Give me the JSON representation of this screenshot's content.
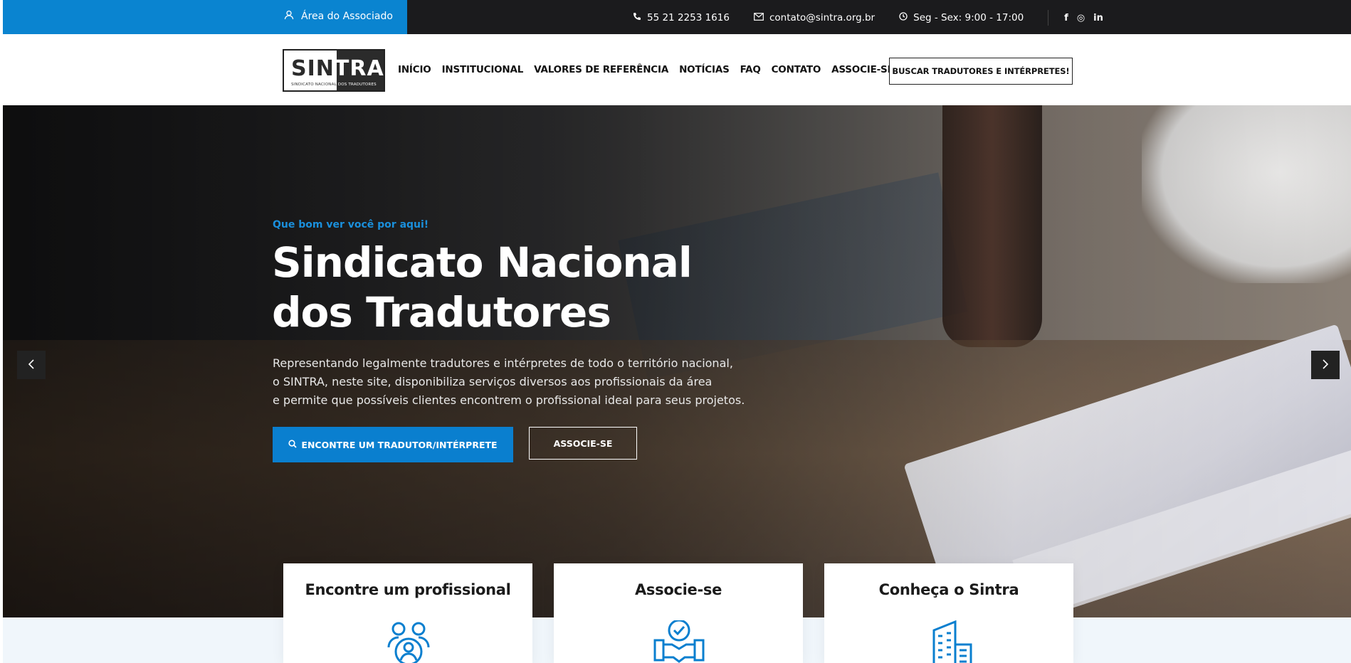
{
  "topbar": {
    "associate_label": "Área do Associado",
    "phone": "55 21 2253 1616",
    "email": "contato@sintra.org.br",
    "hours": "Seg - Sex: 9:00 - 17:00",
    "social": [
      {
        "name": "facebook-icon",
        "glyph": "f"
      },
      {
        "name": "instagram-icon",
        "glyph": "◎"
      },
      {
        "name": "linkedin-icon",
        "glyph": "in"
      }
    ]
  },
  "header": {
    "logo": {
      "word_part1": "SIN",
      "word_part2": "TRA",
      "tagline_part1": "SINDICATO NACIONAL",
      "tagline_part2": "DOS TRADUTORES"
    },
    "nav": [
      "INÍCIO",
      "INSTITUCIONAL",
      "VALORES DE REFERÊNCIA",
      "NOTÍCIAS",
      "FAQ",
      "CONTATO",
      "ASSOCIE-SE"
    ],
    "search_button": "BUSCAR TRADUTORES E INTÉRPRETES!"
  },
  "hero": {
    "kicker": "Que bom ver você por aqui!",
    "title_line1": "Sindicato Nacional",
    "title_line2": "dos Tradutores",
    "desc_line1": "Representando legalmente tradutores e intérpretes de todo o território nacional,",
    "desc_line2": "o SINTRA, neste site, disponibiliza serviços diversos aos profissionais da área",
    "desc_line3": "e permite que possíveis clientes encontrem o profissional ideal para seus projetos.",
    "primary_button": "ENCONTRE UM TRADUTOR/INTÉRPRETE",
    "secondary_button": "ASSOCIE-SE"
  },
  "cards": [
    {
      "title": "Encontre um profissional",
      "icon": "people-icon"
    },
    {
      "title": "Associe-se",
      "icon": "handshake-icon"
    },
    {
      "title": "Conheça o Sintra",
      "icon": "building-icon"
    }
  ],
  "colors": {
    "accent": "#0a84d0",
    "topbar": "#1b1b1d",
    "kicker": "#1a8fdb"
  }
}
